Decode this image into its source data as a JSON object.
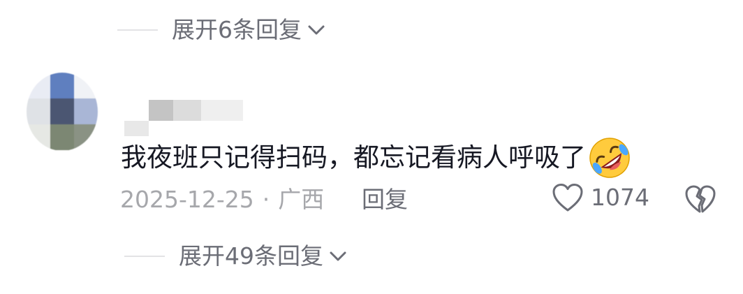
{
  "replies_top": {
    "label": "展开6条回复"
  },
  "comment": {
    "text": "我夜班只记得扫码，都忘记看病人呼吸了",
    "emoji_icon": "rolling-on-floor-laughing-icon",
    "date": "2025-12-25",
    "separator": "·",
    "location": "广西",
    "reply_label": "回复",
    "like_count": "1074"
  },
  "replies_bottom": {
    "label": "展开49条回复"
  },
  "colors": {
    "primary_text": "#161823",
    "secondary_text": "#6b6d76",
    "meta_text": "#a6a7ab"
  }
}
